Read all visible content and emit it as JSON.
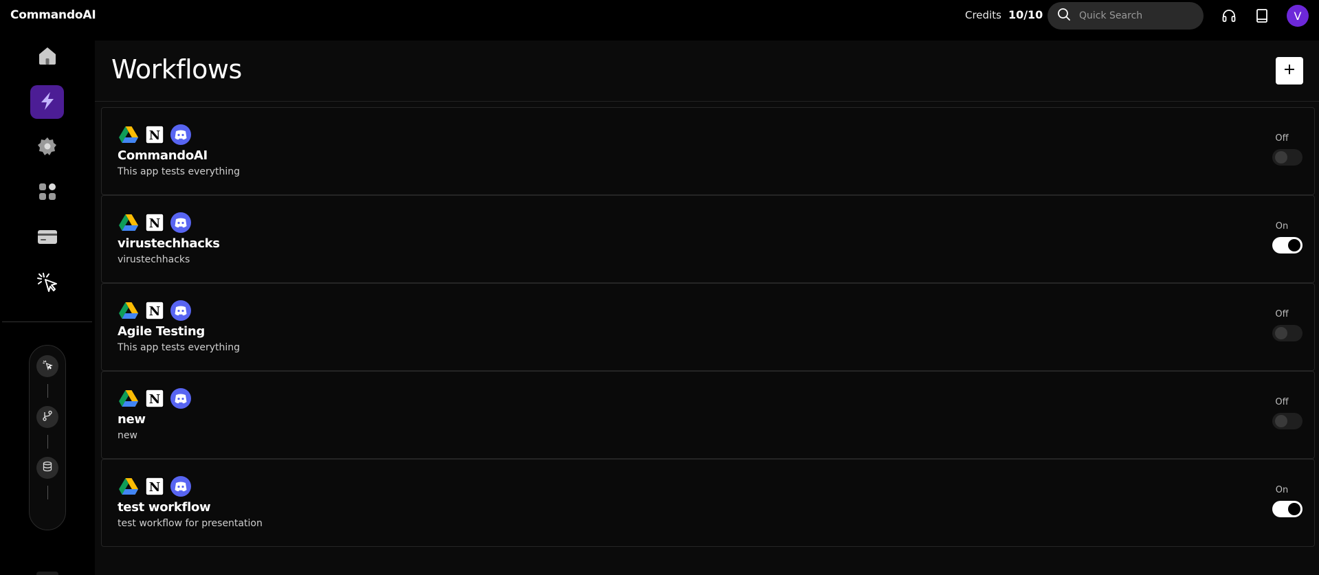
{
  "header": {
    "brand": "CommandoAI",
    "credits_label": "Credits",
    "credits_value": "10/10",
    "search_placeholder": "Quick Search",
    "avatar_initial": "V"
  },
  "sidebar": {
    "items": [
      {
        "icon": "home-icon",
        "active": false
      },
      {
        "icon": "lightning-icon",
        "active": true
      },
      {
        "icon": "gear-icon",
        "active": false
      },
      {
        "icon": "apps-grid-icon",
        "active": false
      },
      {
        "icon": "credit-card-icon",
        "active": false
      },
      {
        "icon": "cursor-click-icon",
        "active": false
      }
    ],
    "flow_nodes": [
      "cursor-click-icon",
      "branch-icon",
      "database-icon"
    ]
  },
  "page": {
    "title": "Workflows"
  },
  "workflows": [
    {
      "title": "CommandoAI",
      "description": "This app tests everything",
      "status": "Off",
      "enabled": false,
      "apps": [
        "google-drive-icon",
        "notion-icon",
        "discord-icon"
      ]
    },
    {
      "title": "virustechhacks",
      "description": "virustechhacks",
      "status": "On",
      "enabled": true,
      "apps": [
        "google-drive-icon",
        "notion-icon",
        "discord-icon"
      ]
    },
    {
      "title": "Agile Testing",
      "description": "This app tests everything",
      "status": "Off",
      "enabled": false,
      "apps": [
        "google-drive-icon",
        "notion-icon",
        "discord-icon"
      ]
    },
    {
      "title": "new",
      "description": "new",
      "status": "Off",
      "enabled": false,
      "apps": [
        "google-drive-icon",
        "notion-icon",
        "discord-icon"
      ]
    },
    {
      "title": "test workflow",
      "description": "test workflow for presentation",
      "status": "On",
      "enabled": true,
      "apps": [
        "google-drive-icon",
        "notion-icon",
        "discord-icon"
      ]
    }
  ],
  "colors": {
    "accent": "#4c1d95",
    "avatar": "#6d28d9",
    "discord": "#5865f2"
  }
}
